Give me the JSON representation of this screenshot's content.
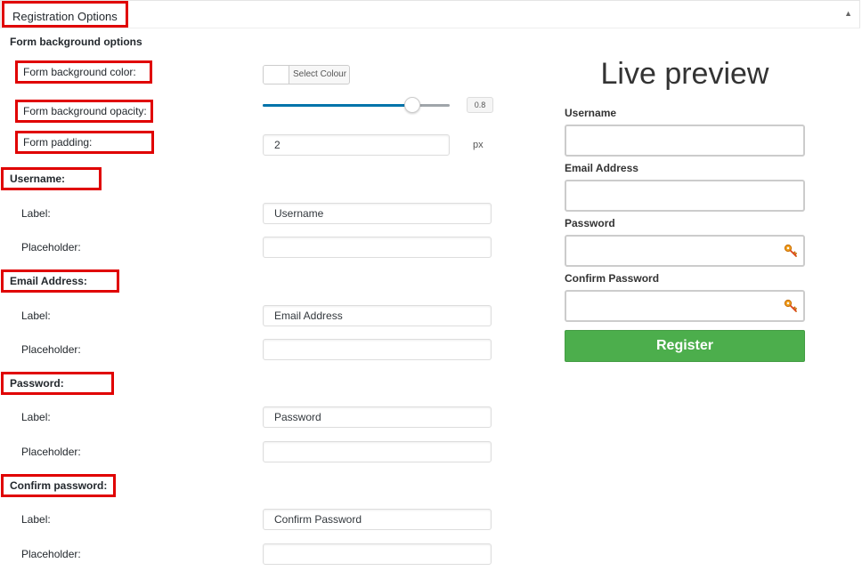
{
  "panel": {
    "title": "Registration Options",
    "collapse_icon": "triangle-up-icon"
  },
  "bg_options": {
    "section_title": "Form background options",
    "color_label": "Form background color:",
    "color_button": "Select Colour",
    "opacity_label": "Form background opacity:",
    "opacity_value": "0.8",
    "padding_label": "Form padding:",
    "padding_value": "2",
    "padding_unit": "px"
  },
  "fields": {
    "username": {
      "title": "Username:",
      "label_text": "Label:",
      "placeholder_text": "Placeholder:",
      "label_value": "Username",
      "placeholder_value": ""
    },
    "email": {
      "title": "Email Address:",
      "label_text": "Label:",
      "placeholder_text": "Placeholder:",
      "label_value": "Email Address",
      "placeholder_value": ""
    },
    "password": {
      "title": "Password:",
      "label_text": "Label:",
      "placeholder_text": "Placeholder:",
      "label_value": "Password",
      "placeholder_value": ""
    },
    "confirm": {
      "title": "Confirm password:",
      "label_text": "Label:",
      "placeholder_text": "Placeholder:",
      "label_value": "Confirm Password",
      "placeholder_value": ""
    }
  },
  "preview": {
    "title": "Live preview",
    "username_label": "Username",
    "email_label": "Email Address",
    "password_label": "Password",
    "confirm_label": "Confirm Password",
    "register_button": "Register"
  },
  "colors": {
    "highlight": "#e00000",
    "register": "#4cae4c",
    "slider_fill": "#0073aa"
  }
}
